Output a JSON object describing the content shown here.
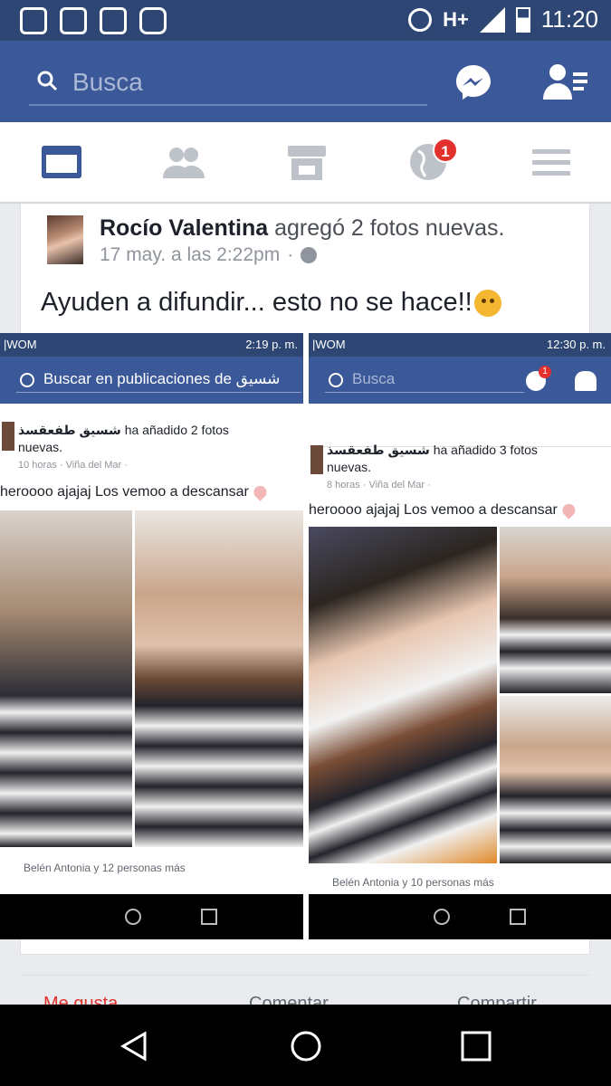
{
  "status_bar": {
    "network": "H+",
    "time": "11:20",
    "icons": [
      "phone-sync-icon",
      "message-icon",
      "image-icon",
      "download-icon",
      "alarm-icon",
      "signal-icon",
      "battery-icon"
    ]
  },
  "header": {
    "search_placeholder": "Busca",
    "icons": [
      "search-icon",
      "messenger-icon",
      "friend-requests-icon"
    ]
  },
  "tabs": {
    "items": [
      "news-feed-tab",
      "friends-tab",
      "marketplace-tab",
      "notifications-tab",
      "menu-tab"
    ],
    "notifications_badge": "1",
    "accent": "#3b5998"
  },
  "post": {
    "author": "Rocío Valentina",
    "action": "agregó 2 fotos nuevas.",
    "timestamp": "17 may. a las 2:22pm",
    "separator": "·",
    "text": "Ayuden a difundir... esto no se hace!!"
  },
  "embedded": {
    "left": {
      "carrier": "|WOM",
      "time": "2:19 p. m.",
      "search": "Buscar en publicaciones de شسيق",
      "author": "شسيق طفعقسذ",
      "action_line1": "ha añadido 2 fotos",
      "action_line2": "nuevas.",
      "meta": "10 horas · Viña del Mar ·",
      "text": "heroooo ajajaj Los vemoo a descansar",
      "reactions": "Belén Antonia y 12 personas más"
    },
    "right": {
      "carrier": "|WOM",
      "time": "12:30 p. m.",
      "search": "Busca",
      "badge": "1",
      "author": "شسيق طفعقسذ",
      "action_line1": "ha añadido 3 fotos",
      "action_line2": "nuevas.",
      "meta": "8 horas · Viña del Mar ·",
      "text": "heroooo ajajaj Los vemoo a descansar",
      "reactions": "Belén Antonia y 10 personas más"
    }
  },
  "footer": {
    "like": "Me gusta",
    "comment": "Comentar",
    "share": "Compartir"
  }
}
